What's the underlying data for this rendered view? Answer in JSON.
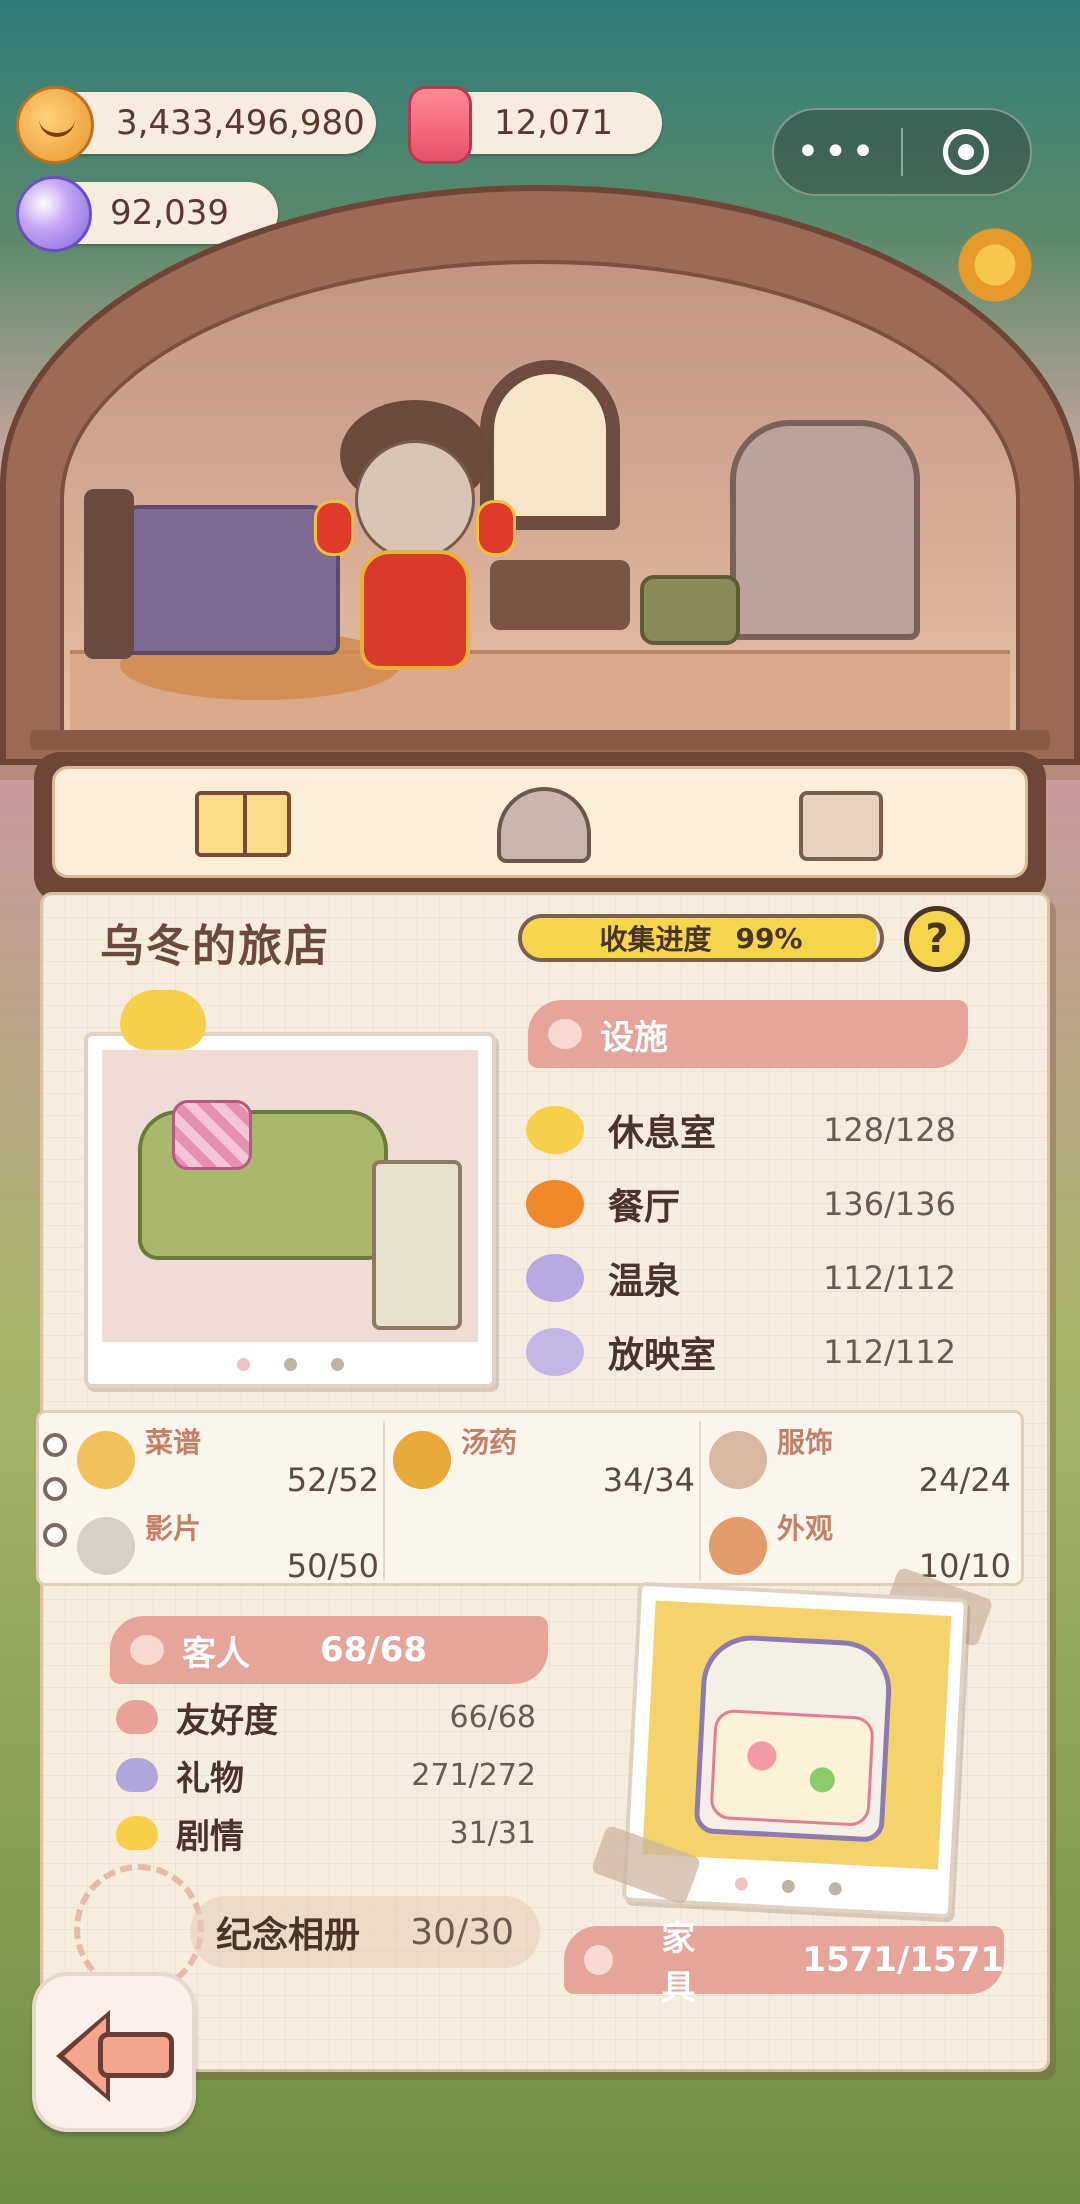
{
  "currency": {
    "coins": "3,433,496,980",
    "candy": "12,071",
    "gems": "92,039"
  },
  "tabs": [
    {
      "name": "book-icon",
      "active": true
    },
    {
      "name": "hotel-icon",
      "active": false
    },
    {
      "name": "shirt-icon",
      "active": false
    }
  ],
  "inn": {
    "title": "乌冬的旅店",
    "progress_label": "收集进度",
    "progress_value": "99%",
    "progress_fraction": 0.99,
    "help": "?"
  },
  "facilities": {
    "header": "设施",
    "items": [
      {
        "label": "休息室",
        "value": "128/128",
        "icon": "cloud-icon",
        "color": "#f7d04a"
      },
      {
        "label": "餐厅",
        "value": "136/136",
        "icon": "fork-knife-icon",
        "color": "#f0892a"
      },
      {
        "label": "温泉",
        "value": "112/112",
        "icon": "hot-spring-icon",
        "color": "#b8a9e0"
      },
      {
        "label": "放映室",
        "value": "112/112",
        "icon": "film-reel-icon",
        "color": "#c3b7e8"
      }
    ]
  },
  "categories": [
    {
      "label": "菜谱",
      "value": "52/52",
      "icon": "pie-icon",
      "color": "#f2c25a"
    },
    {
      "label": "汤药",
      "value": "34/34",
      "icon": "pot-icon",
      "color": "#e8a93a"
    },
    {
      "label": "服饰",
      "value": "24/24",
      "icon": "bear-outfit-icon",
      "color": "#d8b8a0"
    },
    {
      "label": "影片",
      "value": "50/50",
      "icon": "clapper-icon",
      "color": "#d8d0c6"
    },
    {
      "label": "外观",
      "value": "10/10",
      "icon": "house-icon",
      "color": "#e39b6a"
    }
  ],
  "guests": {
    "header": "客人",
    "count": "68/68",
    "items": [
      {
        "label": "友好度",
        "value": "66/68",
        "icon": "heart-icon",
        "color": "#e8a299"
      },
      {
        "label": "礼物",
        "value": "271/272",
        "icon": "gift-heart-icon",
        "color": "#b0a6dc"
      },
      {
        "label": "剧情",
        "value": "31/31",
        "icon": "story-heart-icon",
        "color": "#f7d04a"
      }
    ],
    "album_label": "纪念相册",
    "album_value": "30/30"
  },
  "furniture": {
    "label": "家具",
    "value": "1571/1571"
  }
}
